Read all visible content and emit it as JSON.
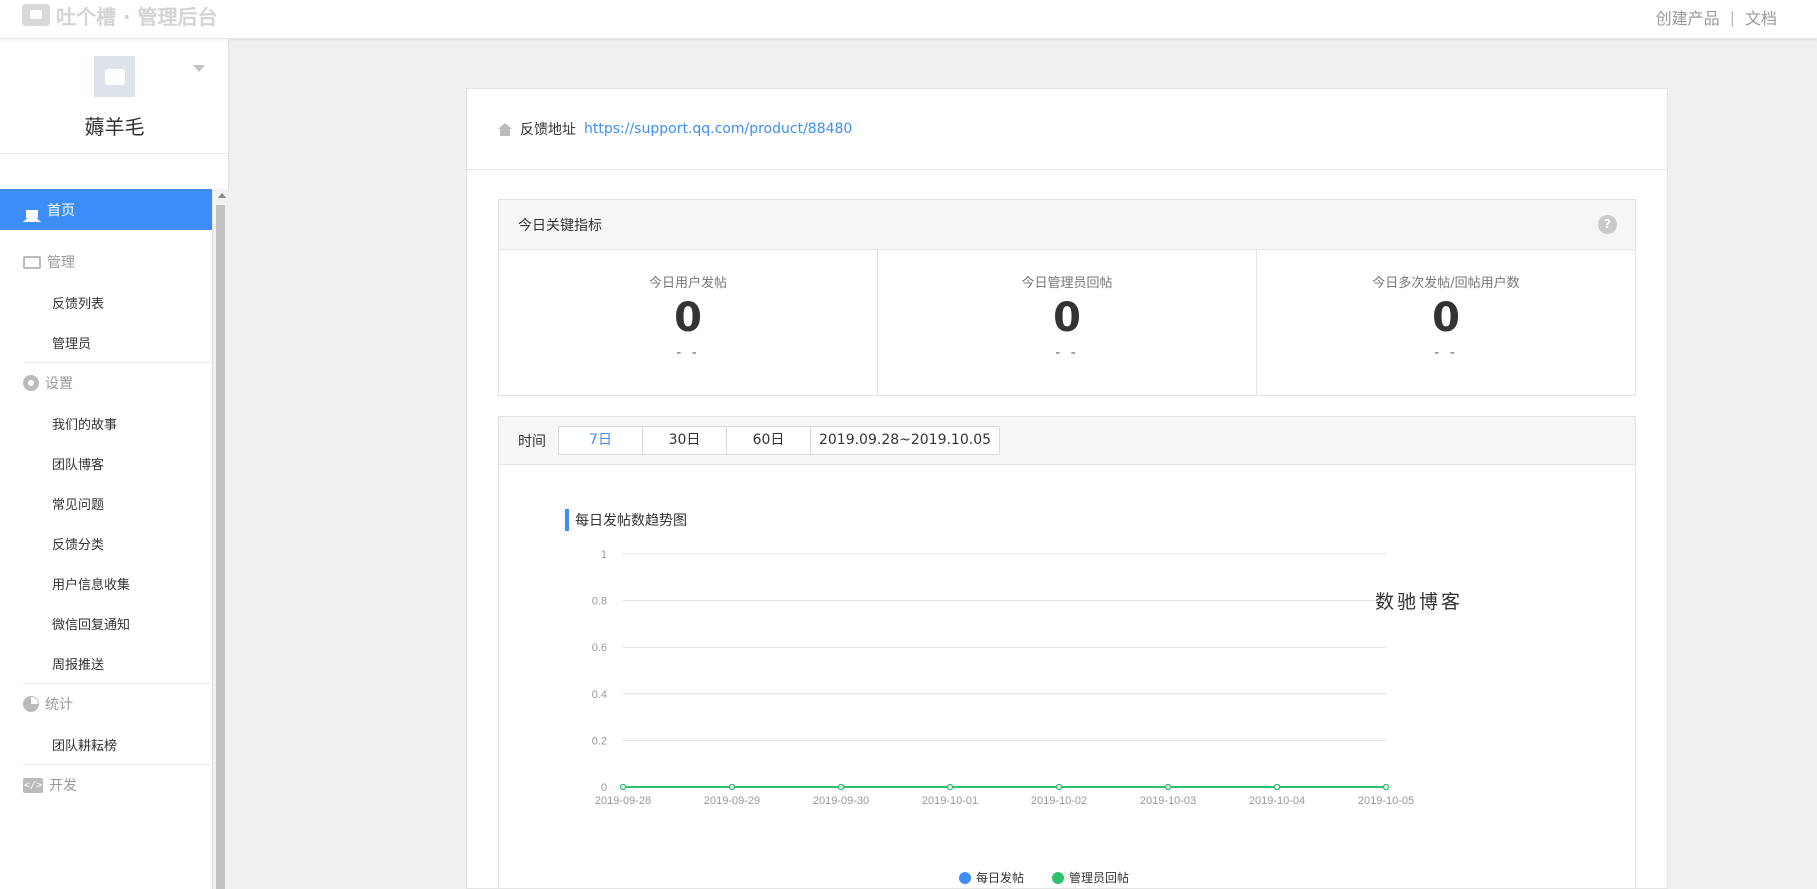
{
  "header": {
    "logo_text": "吐个槽 · 管理后台",
    "links": [
      "创建产品",
      "文档"
    ],
    "separator": "|"
  },
  "sidebar": {
    "profile_name": "薅羊毛",
    "active_item": "首页",
    "groups": [
      {
        "label": "管理",
        "icon": "tray-icon",
        "items": [
          "反馈列表",
          "管理员"
        ]
      },
      {
        "label": "设置",
        "icon": "gear-icon",
        "items": [
          "我们的故事",
          "团队博客",
          "常见问题",
          "反馈分类",
          "用户信息收集",
          "微信回复通知",
          "周报推送"
        ]
      },
      {
        "label": "统计",
        "icon": "pie-chart-icon",
        "items": [
          "团队耕耘榜"
        ]
      },
      {
        "label": "开发",
        "icon": "code-icon",
        "items": []
      }
    ]
  },
  "feedback": {
    "label": "反馈地址",
    "url": "https://support.qq.com/product/88480"
  },
  "kpi": {
    "title": "今日关键指标",
    "help": "?",
    "cells": [
      {
        "label": "今日用户发帖",
        "value": "0",
        "sub": "- -"
      },
      {
        "label": "今日管理员回帖",
        "value": "0",
        "sub": "- -"
      },
      {
        "label": "今日多次发帖/回帖用户数",
        "value": "0",
        "sub": "- -"
      }
    ]
  },
  "time_filter": {
    "label": "时间",
    "options": [
      "7日",
      "30日",
      "60日"
    ],
    "selected": "7日",
    "range": "2019.09.28~2019.10.05"
  },
  "watermark": "数驰博客",
  "chart_data": {
    "type": "line",
    "title": "每日发帖数趋势图",
    "x": [
      "2019-09-28",
      "2019-09-29",
      "2019-09-30",
      "2019-10-01",
      "2019-10-02",
      "2019-10-03",
      "2019-10-04",
      "2019-10-05"
    ],
    "yticks": [
      "1",
      "0.8",
      "0.6",
      "0.4",
      "0.2",
      "0"
    ],
    "ylim": [
      0,
      1
    ],
    "grid": true,
    "legend_position": "bottom-center",
    "series": [
      {
        "name": "每日发帖",
        "color": "#3d8ef8",
        "values": [
          0,
          0,
          0,
          0,
          0,
          0,
          0,
          0
        ]
      },
      {
        "name": "管理员回帖",
        "color": "#2ec06a",
        "values": [
          0,
          0,
          0,
          0,
          0,
          0,
          0,
          0
        ]
      }
    ]
  }
}
